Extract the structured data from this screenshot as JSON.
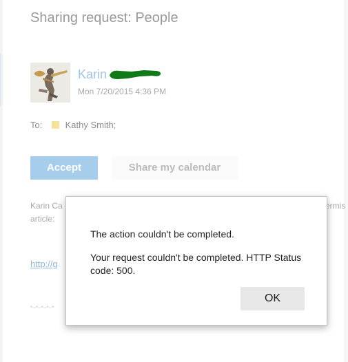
{
  "email": {
    "subject": "Sharing request: People",
    "sender_name": "Karin",
    "sent_time": "Mon 7/20/2015 4:36 PM",
    "to_label": "To:",
    "recipient": "Kathy Smith;",
    "accept_label": "Accept",
    "share_label": "Share my calendar",
    "body_line_1": "Karin Ca",
    "body_line_1_tail": "ermis",
    "body_line_2": "article:",
    "body_link": "http://g",
    "signature_fragment": "*~*~*~*~*"
  },
  "dialog": {
    "title": "The action couldn't be completed.",
    "message": "Your request couldn't be completed. HTTP Status code: 500.",
    "ok_label": "OK"
  },
  "colors": {
    "accent": "#a6cdec",
    "sender": "#9cc5e6",
    "redaction": "#0f7a17",
    "recipient_swatch": "#f6e39a"
  },
  "icons": {
    "avatar": "trombone-player-avatar",
    "recipient": "recipient-color-swatch"
  }
}
